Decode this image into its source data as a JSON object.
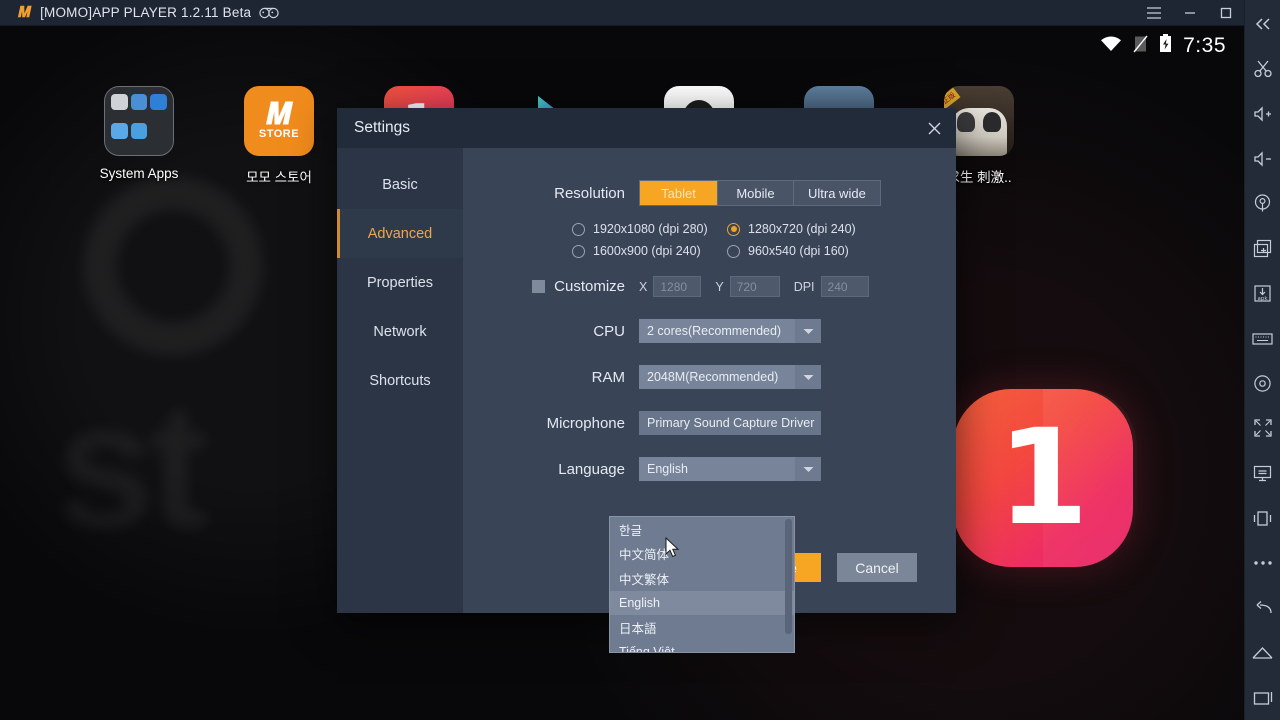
{
  "window": {
    "logo_icon": "momo-logo-icon",
    "title": "[MOMO]APP PLAYER 1.2.11 Beta",
    "gamepad_icon": "gamepad-icon",
    "controls": [
      {
        "name": "menu-button",
        "icon": "hamburger-icon"
      },
      {
        "name": "minimize-button",
        "icon": "minimize-icon"
      },
      {
        "name": "maximize-button",
        "icon": "maximize-icon"
      },
      {
        "name": "close-button",
        "icon": "close-icon"
      }
    ]
  },
  "android": {
    "statusbar": {
      "wifi_icon": "wifi-icon",
      "sim_icon": "no-sim-icon",
      "battery_icon": "battery-charging-icon",
      "time": "7:35"
    },
    "desktop_icons": [
      {
        "label": "System Apps",
        "icon": "system-apps-folder-icon"
      },
      {
        "label": "모모 스토어",
        "icon": "momo-store-icon"
      },
      {
        "label": "",
        "icon": "one-app-icon"
      },
      {
        "label": "",
        "icon": "google-play-icon"
      },
      {
        "label": "",
        "icon": "qq-icon"
      },
      {
        "label": "",
        "icon": "pubg-icon"
      },
      {
        "label": "求生 刺激..",
        "icon": "pubg-cn-icon"
      }
    ],
    "logo_digit": "1"
  },
  "sidebar": {
    "items": [
      {
        "name": "collapse-sidebar-button",
        "icon": "chevron-double-left-icon"
      },
      {
        "name": "screenshot-button",
        "icon": "scissors-icon"
      },
      {
        "name": "volume-up-button",
        "icon": "volume-up-icon"
      },
      {
        "name": "volume-down-button",
        "icon": "volume-down-icon"
      },
      {
        "name": "location-button",
        "icon": "location-pin-icon"
      },
      {
        "name": "new-window-button",
        "icon": "add-window-icon"
      },
      {
        "name": "install-apk-button",
        "icon": "apk-install-icon"
      },
      {
        "name": "keyboard-button",
        "icon": "keyboard-icon"
      },
      {
        "name": "settings-button",
        "icon": "gear-icon"
      },
      {
        "name": "fullscreen-button",
        "icon": "fullscreen-icon"
      },
      {
        "name": "display-button",
        "icon": "monitor-icon"
      },
      {
        "name": "rotate-button",
        "icon": "rotate-screen-icon"
      },
      {
        "name": "more-button",
        "icon": "more-dots-icon"
      },
      {
        "name": "back-button",
        "icon": "back-arrow-icon"
      },
      {
        "name": "home-button",
        "icon": "home-icon"
      },
      {
        "name": "recents-button",
        "icon": "recents-icon"
      }
    ]
  },
  "settings": {
    "title": "Settings",
    "close_icon": "close-icon",
    "tabs": [
      {
        "label": "Basic",
        "active": false
      },
      {
        "label": "Advanced",
        "active": true
      },
      {
        "label": "Properties",
        "active": false
      },
      {
        "label": "Network",
        "active": false
      },
      {
        "label": "Shortcuts",
        "active": false
      }
    ],
    "resolution": {
      "label": "Resolution",
      "modes": [
        {
          "label": "Tablet",
          "selected": true
        },
        {
          "label": "Mobile",
          "selected": false
        },
        {
          "label": "Ultra wide",
          "selected": false
        }
      ],
      "options": [
        {
          "label": "1920x1080 (dpi 280)",
          "selected": false
        },
        {
          "label": "1280x720 (dpi 240)",
          "selected": true
        },
        {
          "label": "1600x900 (dpi 240)",
          "selected": false
        },
        {
          "label": "960x540 (dpi 160)",
          "selected": false
        }
      ]
    },
    "customize": {
      "label": "Customize",
      "checked": false,
      "x_label": "X",
      "x_value": "1280",
      "y_label": "Y",
      "y_value": "720",
      "dpi_label": "DPI",
      "dpi_value": "240"
    },
    "cpu": {
      "label": "CPU",
      "value": "2 cores(Recommended)"
    },
    "ram": {
      "label": "RAM",
      "value": "2048M(Recommended)"
    },
    "microphone": {
      "label": "Microphone",
      "value": "Primary Sound Capture Driver"
    },
    "language": {
      "label": "Language",
      "value": "English",
      "options": [
        {
          "label": "한글",
          "highlighted": false
        },
        {
          "label": "中文简体",
          "highlighted": false
        },
        {
          "label": "中文繁体",
          "highlighted": false
        },
        {
          "label": "English",
          "highlighted": true
        },
        {
          "label": "日本語",
          "highlighted": false
        },
        {
          "label": "Tiếng Việt",
          "highlighted": false
        }
      ]
    },
    "buttons": {
      "save": "Save",
      "cancel": "Cancel"
    }
  },
  "colors": {
    "accent_orange": "#f6a623",
    "dialog_bg": "#394456",
    "titlebar_bg": "#1e2633",
    "sidebar_bg": "#242b38"
  }
}
